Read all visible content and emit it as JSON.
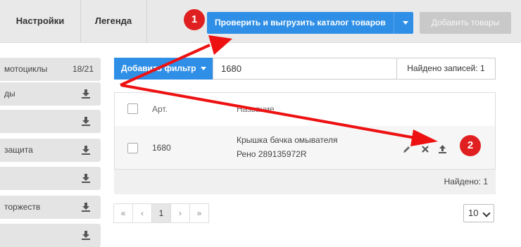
{
  "header": {
    "tabs": [
      {
        "label": "Настройки"
      },
      {
        "label": "Легенда"
      }
    ],
    "primary_button_label": "Проверить и выгрузить каталог товаров",
    "disabled_button_label": "Добавить товары"
  },
  "sidebar": {
    "items": [
      {
        "label": "мотоциклы",
        "count": "18/21"
      },
      {
        "label": "ды"
      },
      {
        "label": ""
      },
      {
        "label": "защита"
      },
      {
        "label": ""
      },
      {
        "label": "торжеств"
      },
      {
        "label": ""
      }
    ]
  },
  "toolbar": {
    "filter_button_label": "Добавить фильтр",
    "search_value": "1680",
    "records_found": "Найдено записей: 1"
  },
  "table": {
    "columns": [
      "Арт.",
      "Название"
    ],
    "rows": [
      {
        "art": "1680",
        "name_line1": "Крышка бачка омывателя",
        "name_line2": "Рено 289135972R"
      }
    ],
    "footer_count": "Найдено: 1"
  },
  "pagination": {
    "first": "«",
    "prev": "‹",
    "current": "1",
    "next": "›",
    "last": "»",
    "per_page": "10"
  },
  "annotations": {
    "badge1": "1",
    "badge2": "2",
    "arrow_color": "#ee1111"
  },
  "colors": {
    "accent": "#2f8fe6",
    "badge": "#e02020"
  }
}
